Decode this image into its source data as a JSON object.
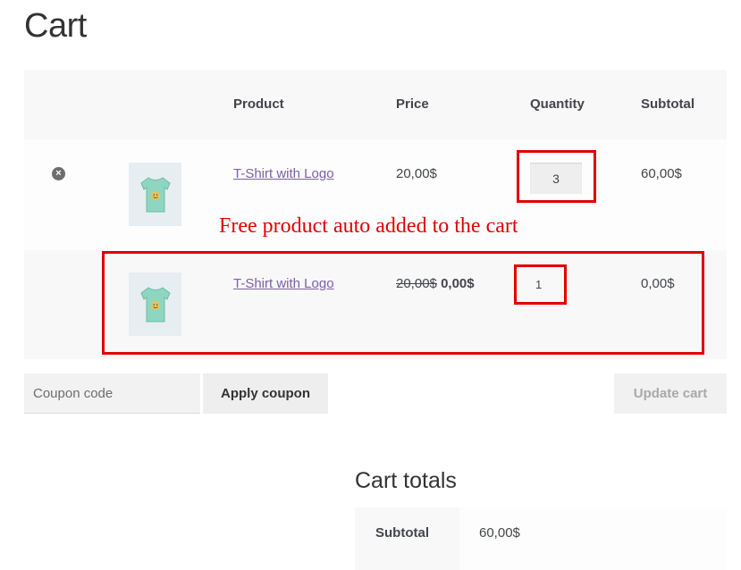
{
  "page": {
    "title": "Cart"
  },
  "table": {
    "headers": {
      "product": "Product",
      "price": "Price",
      "quantity": "Quantity",
      "subtotal": "Subtotal"
    },
    "rows": [
      {
        "removable": true,
        "remove_icon": "×",
        "thumbnail_icon": "tshirt-icon",
        "product_name": "T-Shirt with Logo",
        "price": "20,00$",
        "quantity": "3",
        "subtotal": "60,00$"
      },
      {
        "removable": false,
        "thumbnail_icon": "tshirt-icon",
        "product_name": "T-Shirt with Logo",
        "old_price": "20,00$",
        "new_price": "0,00$",
        "quantity": "1",
        "subtotal": "0,00$"
      }
    ]
  },
  "annotation": {
    "text": "Free product auto added to the cart",
    "color": "#e00000"
  },
  "actions": {
    "coupon_placeholder": "Coupon code",
    "apply_coupon_label": "Apply coupon",
    "update_cart_label": "Update cart"
  },
  "totals": {
    "title": "Cart totals",
    "subtotal_label": "Subtotal",
    "subtotal_value": "60,00$"
  },
  "colors": {
    "link": "#7c5ea8",
    "annotation_red": "#e00000",
    "header_bg": "#f8f8f8"
  }
}
